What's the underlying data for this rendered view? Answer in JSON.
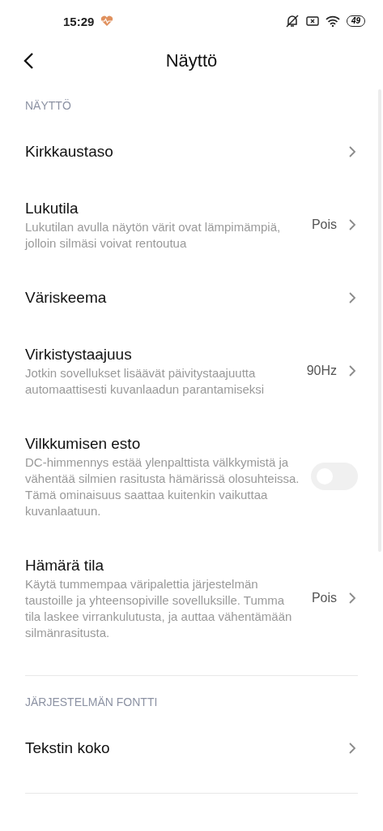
{
  "status_bar": {
    "time": "15:29",
    "battery": "49"
  },
  "header": {
    "title": "Näyttö"
  },
  "sections": [
    {
      "title": "NÄYTTÖ",
      "items": [
        {
          "kind": "link",
          "title": "Kirkkaustaso"
        },
        {
          "kind": "link",
          "title": "Lukutila",
          "subtitle": "Lukutilan avulla näytön värit ovat lämpimämpiä, jolloin silmäsi voivat rentoutua",
          "value": "Pois"
        },
        {
          "kind": "link",
          "title": "Väriskeema"
        },
        {
          "kind": "link",
          "title": "Virkistystaajuus",
          "subtitle": "Jotkin sovellukset lisäävät päivitystaajuutta automaattisesti kuvanlaadun parantamiseksi",
          "value": "90Hz"
        },
        {
          "kind": "toggle",
          "title": "Vilkkumisen esto",
          "subtitle": "DC-himmennys estää ylenpalttista välkkymistä ja vähentää silmien rasitusta hämärissä olosuhteissa. Tämä ominaisuus saattaa kuitenkin vaikuttaa kuvanlaatuun.",
          "on": false
        },
        {
          "kind": "link",
          "title": "Hämärä tila",
          "subtitle": "Käytä tummempaa väripalettia järjestelmän taustoille ja yhteensopiville sovelluksille. Tumma tila laskee virrankulutusta, ja auttaa vähentämään silmänrasitusta.",
          "value": "Pois"
        }
      ]
    },
    {
      "title": "JÄRJESTELMÄN FONTTI",
      "items": [
        {
          "kind": "link",
          "title": "Tekstin koko"
        }
      ]
    }
  ]
}
